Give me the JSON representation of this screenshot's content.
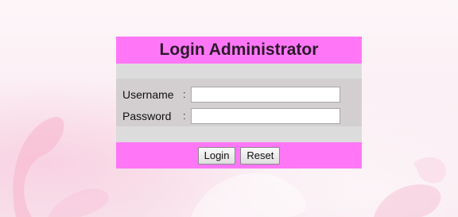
{
  "login": {
    "title": "Login Administrator",
    "username_label": "Username",
    "password_label": "Password",
    "separator": ":",
    "username_value": "",
    "password_value": "",
    "login_button": "Login",
    "reset_button": "Reset"
  },
  "colors": {
    "panel_header": "#ff77f7",
    "form_background": "#d3cfd1",
    "spacer_row": "#dcdcdc",
    "page_background": "#fbeef4"
  }
}
